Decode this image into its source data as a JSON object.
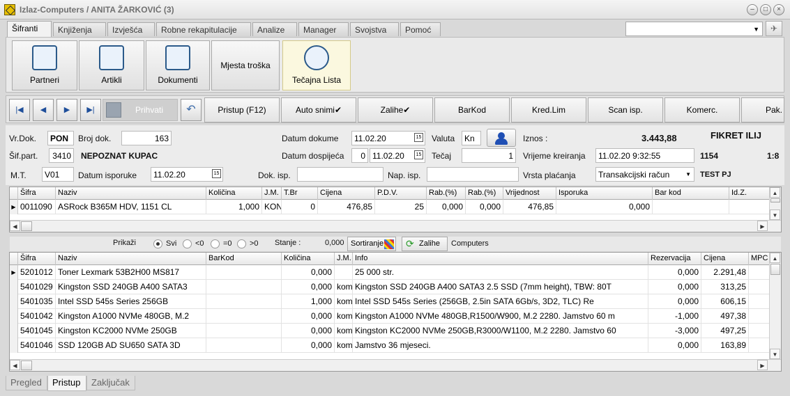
{
  "window": {
    "title": "Izlaz-Computers / ANITA ŽARKOVIĆ (3)"
  },
  "tabs": [
    "Šifranti",
    "Knjiženja",
    "Izvješća",
    "Robne rekapitulacije",
    "Analize",
    "Manager",
    "Svojstva",
    "Pomoć"
  ],
  "ribbon": {
    "partneri": "Partneri",
    "artikli": "Artikli",
    "dokumenti": "Dokumenti",
    "mjesta": "Mjesta troška",
    "tecajna": "Tečajna Lista"
  },
  "toolbar": {
    "prihvati": "Prihvati",
    "pristup": "Pristup (F12)",
    "auto": "Auto snimi✔",
    "zalihe": "Zalihe✔",
    "barkod": "BarKod",
    "kred": "Kred.Lim",
    "scan": "Scan isp.",
    "komerc": "Komerc.",
    "pak": "Pak."
  },
  "doc": {
    "vrdok_label": "Vr.Dok.",
    "vrdok": "PON",
    "brojdok_label": "Broj dok.",
    "brojdok": "163",
    "sifpart_label": "Šif.part.",
    "sifpart": "3410",
    "partner": "NEPOZNAT KUPAC",
    "mt_label": "M.T.",
    "mt": "V01",
    "datisp_label": "Datum isporuke",
    "datisp": "11.02.20",
    "datdok_label": "Datum dokume",
    "datdok": "11.02.20",
    "datdosp_label": "Datum dospijeća",
    "dosp_dani": "0",
    "datdosp": "11.02.20",
    "dokisp_label": "Dok. isp.",
    "napisp_label": "Nap. isp.",
    "valuta_label": "Valuta",
    "valuta": "Kn",
    "tecaj_label": "Tečaj",
    "tecaj": "1",
    "iznos_label": "Iznos :",
    "iznos": "3.443,88",
    "kupac": "FIKRET ILIJ",
    "vrijeme_label": "Vrijeme kreiranja",
    "vrijeme": "11.02.20 9:32:55",
    "broj2": "1154",
    "side": "1:8",
    "placanje_label": "Vrsta plaćanja",
    "placanje": "Transakcijski račun",
    "pj": "TEST PJ"
  },
  "items_grid": {
    "columns": [
      "Šifra",
      "Naziv",
      "Količina",
      "J.M.",
      "T.Br",
      "Cijena",
      "P.D.V.",
      "Rab.(%)",
      "Rab.(%)",
      "Vrijednost",
      "Isporuka",
      "Bar kod",
      "Id.Z."
    ],
    "rows": [
      [
        "0011090",
        "ASRock B365M HDV, 1151 CL",
        "1,000",
        "KON",
        "0",
        "476,85",
        "25",
        "0,000",
        "0,000",
        "476,85",
        "0,000",
        "",
        ""
      ]
    ]
  },
  "filter": {
    "prikazi": "Prikaži",
    "svi": "Svi",
    "lt0": "<0",
    "eq0": "=0",
    "gt0": ">0",
    "stanje_label": "Stanje :",
    "stanje": "0,000",
    "sortiranje": "Sortiranje",
    "zalihe": "Zalihe",
    "computers": "Computers"
  },
  "stock_grid": {
    "columns": [
      "Šifra",
      "Naziv",
      "BarKod",
      "Količina",
      "J.M.",
      "Info",
      "Rezervacija",
      "Cijena",
      "MPC"
    ],
    "rows": [
      [
        "5201012",
        "Toner Lexmark 53B2H00 MS817",
        "",
        "0,000",
        "",
        "25 000 str.",
        "0,000",
        "2.291,48",
        ""
      ],
      [
        "5401029",
        "Kingston SSD 240GB A400 SATA3",
        "",
        "0,000",
        "kom",
        "Kingston SSD 240GB A400 SATA3 2.5 SSD (7mm height), TBW: 80T",
        "0,000",
        "313,25",
        ""
      ],
      [
        "5401035",
        "Intel SSD 545s Series 256GB",
        "",
        "1,000",
        "kom",
        "Intel SSD 545s Series (256GB, 2.5in SATA 6Gb/s, 3D2, TLC) Re",
        "0,000",
        "606,15",
        ""
      ],
      [
        "5401042",
        "Kingston A1000 NVMe 480GB, M.2",
        "",
        "0,000",
        "kom",
        "Kingston A1000 NVMe 480GB,R1500/W900, M.2 2280. Jamstvo 60 m",
        "-1,000",
        "497,38",
        ""
      ],
      [
        "5401045",
        "Kingston KC2000 NVMe 250GB",
        "",
        "0,000",
        "kom",
        "Kingston KC2000 NVMe 250GB,R3000/W1100, M.2 2280. Jamstvo 60",
        "-3,000",
        "497,25",
        ""
      ],
      [
        "5401046",
        "SSD 120GB AD SU650 SATA 3D",
        "",
        "0,000",
        "kom",
        "Jamstvo 36 mjeseci.",
        "0,000",
        "163,89",
        ""
      ]
    ]
  },
  "bottom_tabs": [
    "Pregled",
    "Pristup",
    "Zaključak"
  ]
}
